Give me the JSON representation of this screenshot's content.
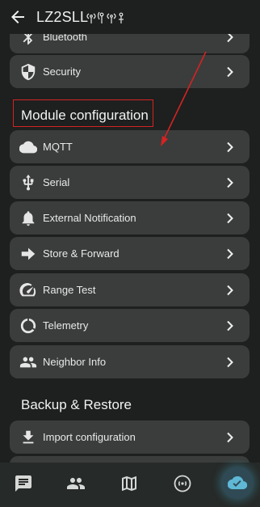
{
  "header": {
    "title": "LZ2SLL"
  },
  "radio_rows": [
    {
      "label": "Bluetooth",
      "icon": "bluetooth-icon"
    },
    {
      "label": "Security",
      "icon": "shield-icon"
    }
  ],
  "module_config": {
    "title": "Module configuration",
    "items": [
      {
        "label": "MQTT",
        "icon": "cloud-icon"
      },
      {
        "label": "Serial",
        "icon": "usb-icon"
      },
      {
        "label": "External Notification",
        "icon": "bell-icon"
      },
      {
        "label": "Store & Forward",
        "icon": "arrow-forward-icon"
      },
      {
        "label": "Range Test",
        "icon": "speedometer-icon"
      },
      {
        "label": "Telemetry",
        "icon": "telemetry-icon"
      },
      {
        "label": "Neighbor Info",
        "icon": "people-icon"
      }
    ]
  },
  "backup": {
    "title": "Backup & Restore",
    "items": [
      {
        "label": "Import configuration",
        "icon": "download-icon"
      }
    ]
  },
  "bottom_nav": [
    {
      "name": "messages",
      "icon": "chat-icon"
    },
    {
      "name": "nodes",
      "icon": "people-icon"
    },
    {
      "name": "map",
      "icon": "map-icon"
    },
    {
      "name": "channels",
      "icon": "signal-icon"
    },
    {
      "name": "settings",
      "icon": "cloud-check-icon",
      "active": true
    }
  ],
  "colors": {
    "background": "#1d201f",
    "row": "#3a3d3b",
    "annotation": "#d42323",
    "nav_active": "#5fb8d6"
  }
}
